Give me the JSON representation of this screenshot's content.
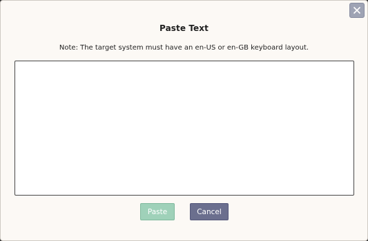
{
  "dialog": {
    "title": "Paste Text",
    "note": "Note: The target system must have an en-US or en-GB keyboard layout.",
    "text_input": {
      "value": "",
      "placeholder": ""
    },
    "buttons": {
      "paste_label": "Paste",
      "cancel_label": "Cancel"
    },
    "close_icon": "close-icon"
  },
  "colors": {
    "dialog_background": "#fcf9f5",
    "paste_button": "#9fd1b9",
    "cancel_button": "#6b6f8e",
    "close_button": "#9ea3b4"
  }
}
